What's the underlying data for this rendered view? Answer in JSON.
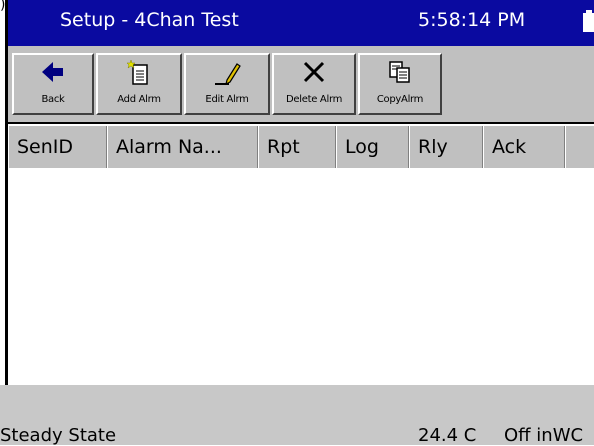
{
  "window": {
    "title": "Setup - 4Chan Test",
    "clock": "5:58:14 PM"
  },
  "toolbar": {
    "buttons": [
      {
        "label": "Back",
        "icon": "back-arrow-icon"
      },
      {
        "label": "Add Alrm",
        "icon": "new-document-icon"
      },
      {
        "label": "Edit Alrm",
        "icon": "pencil-icon"
      },
      {
        "label": "Delete Alrm",
        "icon": "delete-x-icon"
      },
      {
        "label": "CopyAlrm",
        "icon": "copy-icon"
      }
    ]
  },
  "table": {
    "columns": [
      "SenID",
      "Alarm Na...",
      "Rpt",
      "Log",
      "Rly",
      "Ack"
    ],
    "rows": []
  },
  "status": {
    "left": "Steady State",
    "temperature": "24.4 C",
    "unit": "Off inWC"
  },
  "colors": {
    "titlebar": "#0a0aa0",
    "toolbar": "#c0c0c0",
    "statusbar": "#c8c8c8"
  }
}
